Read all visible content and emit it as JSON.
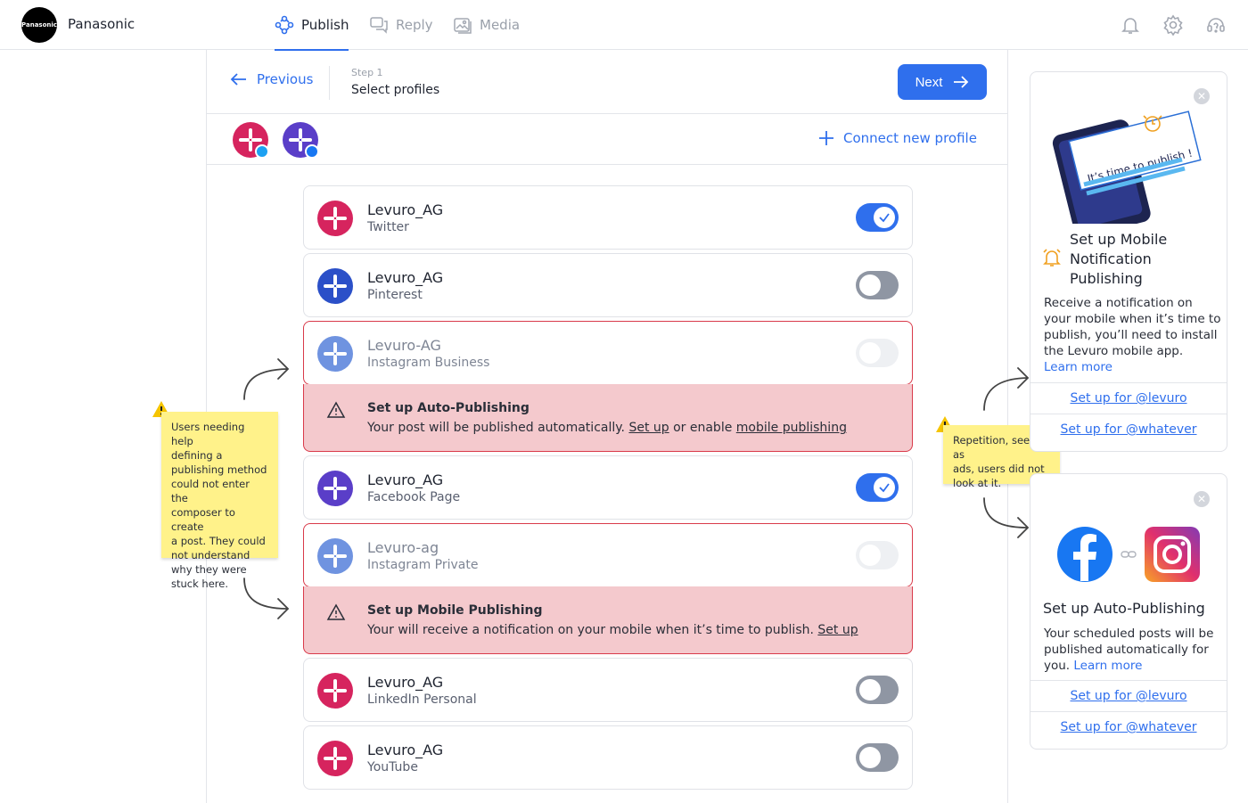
{
  "header": {
    "brand_logo_text": "Panasonic",
    "brand_name": "Panasonic",
    "tabs": [
      {
        "label": "Publish"
      },
      {
        "label": "Reply"
      },
      {
        "label": "Media"
      }
    ]
  },
  "stepbar": {
    "previous_label": "Previous",
    "step_label": "Step 1",
    "step_title": "Select profiles",
    "next_label": "Next"
  },
  "profilebar": {
    "connect_label": "Connect new profile"
  },
  "profiles": [
    {
      "name": "Levuro_AG",
      "network": "Twitter",
      "toggle": "on"
    },
    {
      "name": "Levuro_AG",
      "network": "Pinterest",
      "toggle": "off"
    },
    {
      "name": "Levuro-AG",
      "network": "Instagram Business",
      "toggle": "disabled"
    },
    {
      "name": "Levuro_AG",
      "network": "Facebook Page",
      "toggle": "on"
    },
    {
      "name": "Levuro-ag",
      "network": "Instagram Private",
      "toggle": "disabled"
    },
    {
      "name": "Levuro_AG",
      "network": "LinkedIn Personal",
      "toggle": "off"
    },
    {
      "name": "Levuro_AG",
      "network": "YouTube",
      "toggle": "off"
    }
  ],
  "errors": {
    "auto": {
      "title": "Set up Auto-Publishing",
      "body_pre": "Your post will be published automatically. ",
      "link1": "Set up",
      "body_mid": " or enable ",
      "link2": "mobile publishing"
    },
    "mobile": {
      "title": "Set up Mobile Publishing",
      "body_pre": "Your will receive a notification on your mobile when it’s time to publish. ",
      "link1": "Set up"
    }
  },
  "notes": {
    "left": [
      "Users needing help",
      "defining a",
      "publishing method",
      "could not enter the",
      "composer to create",
      "a post. They could",
      "not understand",
      "why they were",
      "stuck here."
    ],
    "right": [
      "Repetition, seen as",
      "ads, users did not",
      "look at it."
    ]
  },
  "side_mobile": {
    "illustration_text": "It’s time to publish !",
    "title_lines": [
      "Set up Mobile",
      "Notification",
      "Publishing"
    ],
    "body_lines": [
      "Receive a notification on",
      "your mobile when it’s time to",
      "publish, you’ll need to install",
      "the Levuro mobile app."
    ],
    "learn_more": "Learn more",
    "link1": "Set up for @levuro",
    "link2": "Set up for @whatever"
  },
  "side_auto": {
    "title": "Set up Auto-Publishing",
    "body_lines": [
      "Your scheduled posts will be",
      "published automatically for"
    ],
    "body_last": "you. ",
    "learn_more": "Learn more",
    "link1": "Set up for @levuro",
    "link2": "Set up for @whatever"
  },
  "colors": {
    "accent": "#2f6fed",
    "error_border": "#d93a4a",
    "error_bg": "#f4c9cd",
    "sticky": "#fff28a",
    "avatar_pink": "#d6245e",
    "avatar_blue": "#2b50c8",
    "avatar_light": "#6f93e0",
    "avatar_purple": "#5a3ec8"
  },
  "icons": [
    "publish-icon",
    "reply-icon",
    "media-icon",
    "bell-icon",
    "gear-icon",
    "support-icon",
    "arrow-left-icon",
    "arrow-right-icon",
    "plus-icon",
    "warning-icon",
    "check-icon",
    "close-icon",
    "alarm-icon",
    "facebook-icon",
    "instagram-icon",
    "link-icon",
    "twitter-badge-icon",
    "facebook-badge-icon"
  ]
}
